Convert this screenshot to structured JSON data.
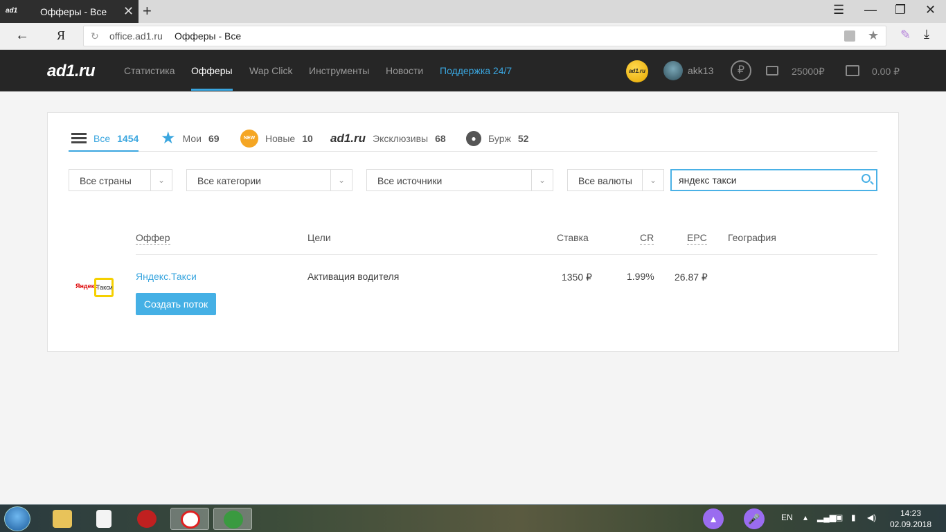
{
  "browser": {
    "tab_title": "Офферы - Все",
    "tab_favicon": "ad1",
    "url_host": "office.ad1.ru",
    "page_title": "Офферы - Все",
    "yandex_button": "Я"
  },
  "header": {
    "logo": "ad1.ru",
    "nav": [
      "Статистика",
      "Офферы",
      "Wap Click",
      "Инструменты",
      "Новости",
      "Поддержка 24/7"
    ],
    "active_nav": "Офферы",
    "badge": "ad1.ru",
    "username": "akk13",
    "currency_icon": "₽",
    "wallet_balance": "25000₽",
    "case_balance": "0.00 ₽"
  },
  "tabs": [
    {
      "label": "Все",
      "count": "1454"
    },
    {
      "label": "Мои",
      "count": "69"
    },
    {
      "label": "Новые",
      "count": "10",
      "icon_text": "NEW"
    },
    {
      "label": "Эксклюзивы",
      "count": "68",
      "icon_text": "ad1.ru"
    },
    {
      "label": "Бурж",
      "count": "52"
    }
  ],
  "filters": {
    "countries": "Все страны",
    "categories": "Все категории",
    "sources": "Все источники",
    "currencies": "Все валюты",
    "search_value": "яндекс такси"
  },
  "table": {
    "headers": [
      "Оффер",
      "Цели",
      "Ставка",
      "CR",
      "EPC",
      "География"
    ],
    "rows": [
      {
        "logo_left": "Яндекс",
        "logo_right": "Такси",
        "offer": "Яндекс.Такси",
        "goal": "Активация водителя",
        "rate": "1350 ₽",
        "cr": "1.99%",
        "epc": "26.87 ₽",
        "geo": "",
        "button": "Создать поток"
      }
    ]
  },
  "taskbar": {
    "lang": "EN",
    "time": "14:23",
    "date": "02.09.2018"
  },
  "colors": {
    "accent": "#3aa6df",
    "header_bg": "#262626",
    "button_bg": "#45b0e5"
  }
}
